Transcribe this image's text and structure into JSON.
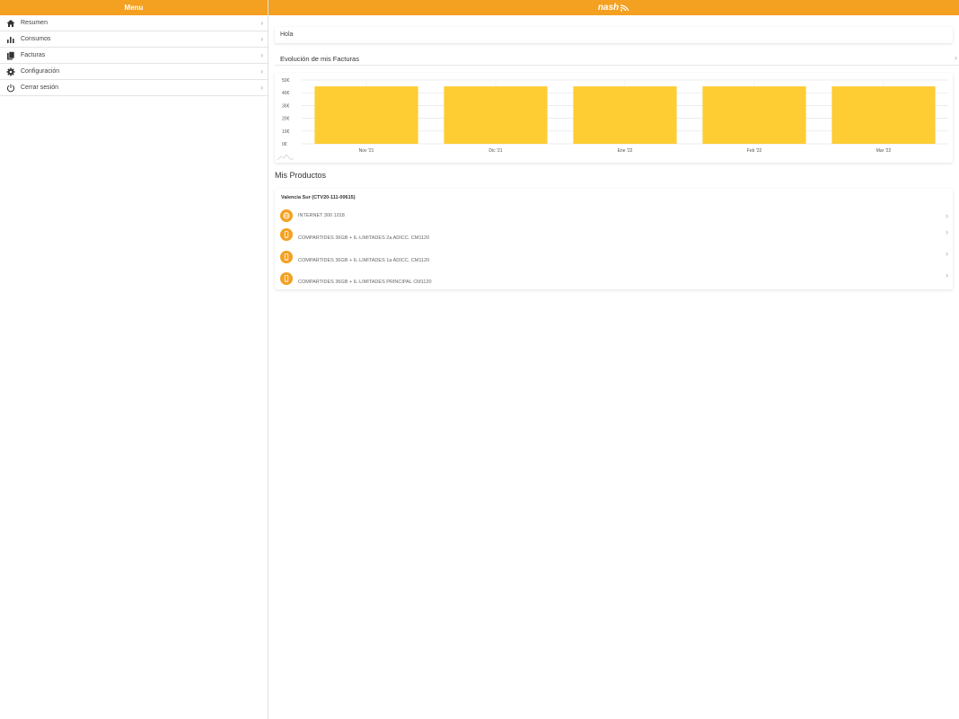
{
  "sidebar": {
    "title": "Menu",
    "items": [
      {
        "label": "Resumen",
        "icon": "home-icon"
      },
      {
        "label": "Consumos",
        "icon": "bar-chart-icon"
      },
      {
        "label": "Facturas",
        "icon": "documents-icon"
      },
      {
        "label": "Configuración",
        "icon": "gear-icon"
      },
      {
        "label": "Cerrar sesión",
        "icon": "power-icon"
      }
    ]
  },
  "header": {
    "logo_text": "nash"
  },
  "main": {
    "greeting": "Hola",
    "invoices_section_title": "Evolución de mis Facturas",
    "products_title": "Mis Productos",
    "store_name": "Valencia Sur (CTV20-111-00615)",
    "products": [
      {
        "label": "INTERNET 300 1018",
        "icon": "globe-icon"
      },
      {
        "label": "COMPARTIDES 36GB + IL·LIMITADES 2a ADICC. CM1120",
        "icon": "mobile-icon"
      },
      {
        "label": "COMPARTIDES 36GB + IL·LIMITADES 1a ADICC. CM1120",
        "icon": "mobile-icon"
      },
      {
        "label": "COMPARTIDES 36GB + IL·LIMITADES PRINCIPAL CM1120",
        "icon": "mobile-icon"
      }
    ]
  },
  "colors": {
    "accent": "#f4a021",
    "bar": "#fecd33"
  },
  "chart_data": {
    "type": "bar",
    "categories": [
      "Nov '21",
      "Dic '21",
      "Ene '22",
      "Feb '22",
      "Mar '22"
    ],
    "values": [
      45,
      45,
      45,
      45,
      45
    ],
    "ylim": [
      0,
      50
    ],
    "yticks": [
      0,
      10,
      20,
      30,
      40,
      50
    ],
    "ytick_labels": [
      "0€",
      "10€",
      "20€",
      "30€",
      "40€",
      "50€"
    ],
    "grid": true
  }
}
